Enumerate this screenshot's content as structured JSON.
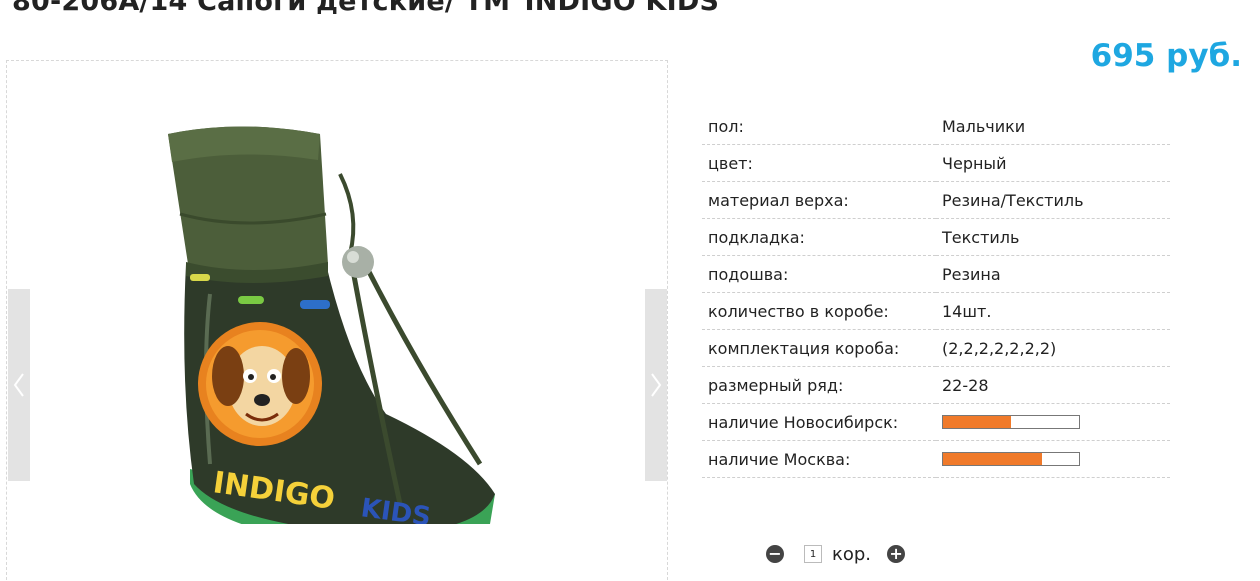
{
  "product": {
    "title": "80-206A/14 Сапоги детские/ ТМ\"INDIGO KIDS\"",
    "price": "695 руб."
  },
  "gallery": {
    "image": "rubber-boot-photo",
    "prev_icon": "chevron-left-icon",
    "next_icon": "chevron-right-icon",
    "logo_text": "INDIGO KIDS"
  },
  "specs": [
    {
      "label": "пол:",
      "value": "Мальчики"
    },
    {
      "label": "цвет:",
      "value": "Черный"
    },
    {
      "label": "материал верха:",
      "value": "Резина/Текстиль"
    },
    {
      "label": "подкладка:",
      "value": "Текстиль"
    },
    {
      "label": "подошва:",
      "value": "Резина"
    },
    {
      "label": "количество в коробе:",
      "value": "14шт."
    },
    {
      "label": "комплектация короба:",
      "value": "(2,2,2,2,2,2,2)"
    },
    {
      "label": "размерный ряд:",
      "value": "22-28"
    }
  ],
  "stock": [
    {
      "label": "наличие Новосибирск:",
      "level": 0.5
    },
    {
      "label": "наличие Москва:",
      "level": 0.73
    }
  ],
  "quantity": {
    "minus_label": "−",
    "value": "1",
    "unit": "кор.",
    "plus_label": "+"
  },
  "colors": {
    "price": "#1ea7e1",
    "stock_fill": "#f07a2a"
  }
}
